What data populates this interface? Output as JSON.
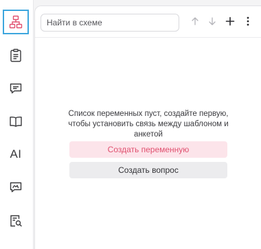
{
  "sidebar": {
    "items": [
      {
        "name": "schema",
        "icon": "schema-icon",
        "active": true
      },
      {
        "name": "document",
        "icon": "document-icon",
        "active": false
      },
      {
        "name": "chat",
        "icon": "chat-icon",
        "active": false
      },
      {
        "name": "book",
        "icon": "book-icon",
        "active": false
      },
      {
        "name": "ai",
        "label": "AI",
        "active": false
      },
      {
        "name": "signature",
        "icon": "signature-chat-icon",
        "active": false
      },
      {
        "name": "search-document",
        "icon": "document-search-icon",
        "active": false
      }
    ],
    "active_color": "#3da6de",
    "active_icon_color": "#e0506f"
  },
  "toolbar": {
    "search_placeholder": "Найти в схеме",
    "icons": [
      "arrow-up-icon",
      "arrow-down-icon",
      "plus-icon",
      "more-vertical-icon"
    ]
  },
  "empty_state": {
    "message": "Список переменных пуст, создайте первую, чтобы установить связь между шаблоном и анкетой",
    "create_variable_label": "Создать переменную",
    "create_question_label": "Создать вопрос"
  },
  "colors": {
    "primary_button_bg": "#fce4ea",
    "primary_button_text": "#e0506f",
    "secondary_button_bg": "#ececee"
  }
}
